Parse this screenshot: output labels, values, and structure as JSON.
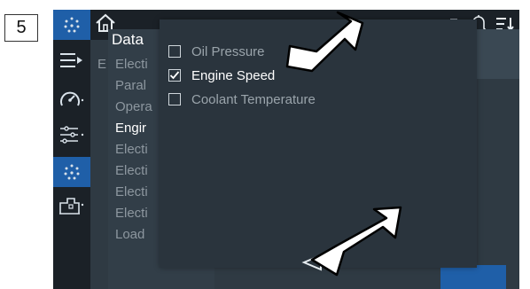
{
  "step_badge": {
    "number": "5"
  },
  "colors": {
    "rail": "#1b2127",
    "active_nav": "#1f5fa8",
    "panel": "#2f3a43",
    "popup": "#2a343d"
  },
  "nav_rail": {
    "items": [
      {
        "name": "engine-config-icon",
        "active": true
      },
      {
        "name": "menu-icon",
        "active": false
      },
      {
        "name": "gauge-icon",
        "active": false
      },
      {
        "name": "settings-sliders-icon",
        "active": false
      },
      {
        "name": "engine-config-icon",
        "active": true
      },
      {
        "name": "plant-icon",
        "active": false
      }
    ]
  },
  "topbar": {
    "home_icon": "home-icon",
    "bell_icon": "bell-icon",
    "sort_icon": "sort-icon"
  },
  "data_panel": {
    "title": "Data",
    "rows": [
      {
        "label": "Electi",
        "highlight": false
      },
      {
        "label": "Paral",
        "highlight": false
      },
      {
        "label": "Opera",
        "highlight": false
      },
      {
        "label": "Engir",
        "highlight": true
      },
      {
        "label": "Electi",
        "highlight": false
      },
      {
        "label": "Electi",
        "highlight": false
      },
      {
        "label": "Electi",
        "highlight": false
      },
      {
        "label": "Electi",
        "highlight": false
      },
      {
        "label": "Load",
        "highlight": false
      }
    ],
    "extra_letter": "E"
  },
  "popup": {
    "options": [
      {
        "label": "Oil Pressure",
        "checked": false
      },
      {
        "label": "Engine Speed",
        "checked": true
      },
      {
        "label": "Coolant Temperature",
        "checked": false
      }
    ],
    "back_button": "back-triangle-icon"
  }
}
